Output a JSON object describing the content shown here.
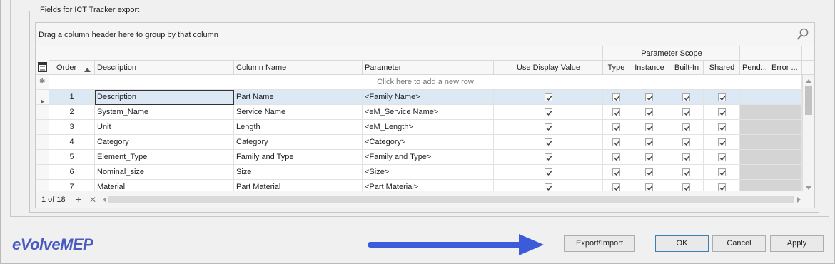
{
  "groupbox": {
    "title": "Fields for ICT Tracker export"
  },
  "grid": {
    "group_hint": "Drag a column header here to group by that column",
    "band_label": "Parameter Scope",
    "columns": {
      "order": "Order",
      "description": "Description",
      "column_name": "Column Name",
      "parameter": "Parameter",
      "use_display_value": "Use Display Value",
      "type": "Type",
      "instance": "Instance",
      "built_in": "Built-In",
      "shared": "Shared",
      "pending": "Pend...",
      "error": "Error ..."
    },
    "new_row_text": "Click here to add a new row",
    "rows": [
      {
        "order": "1",
        "description": "Description",
        "column_name": "Part Name",
        "parameter": "<Family Name>"
      },
      {
        "order": "2",
        "description": "System_Name",
        "column_name": "Service Name",
        "parameter": "<eM_Service Name>"
      },
      {
        "order": "3",
        "description": "Unit",
        "column_name": "Length",
        "parameter": "<eM_Length>"
      },
      {
        "order": "4",
        "description": "Category",
        "column_name": "Category",
        "parameter": "<Category>"
      },
      {
        "order": "5",
        "description": "Element_Type",
        "column_name": "Family and Type",
        "parameter": "<Family and Type>"
      },
      {
        "order": "6",
        "description": "Nominal_size",
        "column_name": "Size",
        "parameter": "<Size>"
      },
      {
        "order": "7",
        "description": "Material",
        "column_name": "Part Material",
        "parameter": "<Part Material>"
      }
    ],
    "navigator": {
      "record_text": "1 of 18",
      "add_symbol": "+",
      "delete_symbol": "✕"
    }
  },
  "footer": {
    "logo_text": "eVolveMEP",
    "export_import_label": "Export/Import",
    "ok_label": "OK",
    "cancel_label": "Cancel",
    "apply_label": "Apply"
  },
  "colors": {
    "selected_row": "#dde8f5",
    "arrow": "#3b5bdb",
    "logo": "#4a5bbf",
    "readonly_cell": "#d4d4d4"
  },
  "icons": {
    "search": "search-icon",
    "column_chooser": "column-chooser-icon",
    "new_row": "asterisk-icon",
    "row_indicator": "row-indicator-icon",
    "sort_ascending": "sort-ascending-icon"
  }
}
